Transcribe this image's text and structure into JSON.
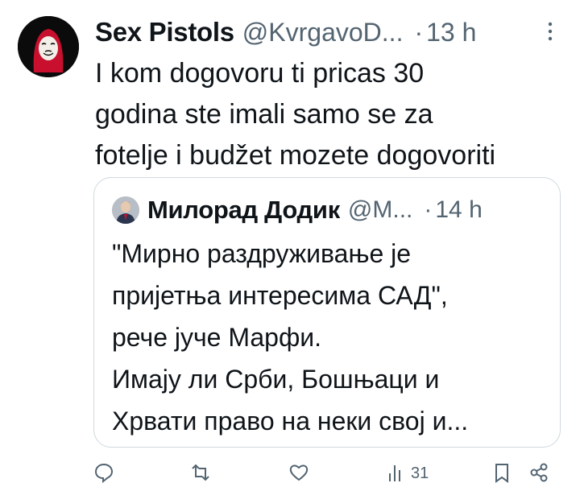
{
  "tweet": {
    "author_name": "Sex Pistols",
    "author_handle": "@KvrgavoD...",
    "separator": "·",
    "time": "13 h",
    "text_lines": [
      "I kom dogovoru ti pricas 30",
      "godina ste imali samo se za",
      "fotelje i budžet mozete dogovoriti"
    ]
  },
  "quoted_tweet": {
    "author_name": "Милорад Додик",
    "author_handle": "@M...",
    "separator": "·",
    "time": "14 h",
    "text_lines": [
      "\"Мирно раздруживање је",
      "пријетња интересима САД\",",
      "рече јуче Марфи.",
      "Имају ли Срби, Бошњаци и",
      "Хрвати право на неки свој и..."
    ]
  },
  "actions": {
    "views_count": "31"
  },
  "icons": {
    "more": "more-vertical-icon",
    "reply": "reply-icon",
    "retweet": "retweet-icon",
    "like": "like-icon",
    "views": "views-icon",
    "bookmark": "bookmark-icon",
    "share": "share-icon"
  },
  "colors": {
    "text_primary": "#0f1419",
    "text_secondary": "#536471",
    "border": "#cfd9de"
  }
}
